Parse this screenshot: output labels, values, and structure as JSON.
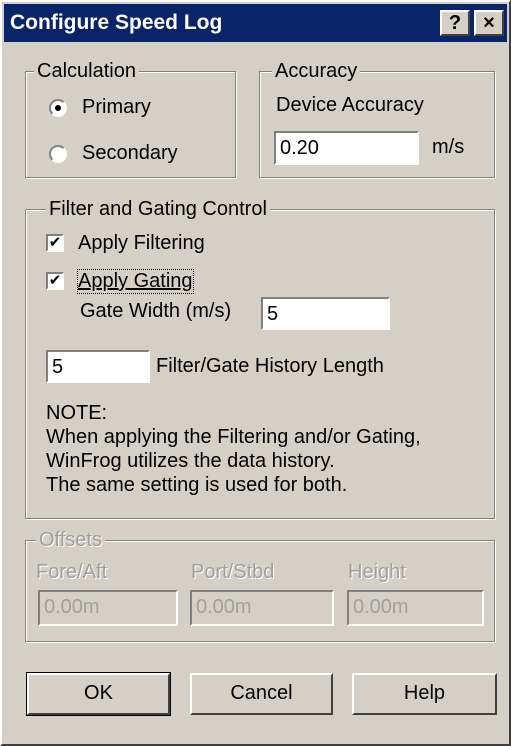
{
  "window": {
    "title": "Configure Speed Log",
    "help_button": "?",
    "close_button": "×"
  },
  "calculation": {
    "title": "Calculation",
    "options": [
      {
        "label": "Primary",
        "selected": true
      },
      {
        "label": "Secondary",
        "selected": false
      }
    ]
  },
  "accuracy": {
    "title": "Accuracy",
    "device_label": "Device Accuracy",
    "value": "0.20",
    "unit": "m/s"
  },
  "filter": {
    "title": "Filter and Gating Control",
    "apply_filtering": {
      "label": "Apply Filtering",
      "checked": true
    },
    "apply_gating": {
      "label": "Apply Gating",
      "checked": true
    },
    "gate_width_label": "Gate Width (m/s)",
    "gate_width_value": "5",
    "history_value": "5",
    "history_label": "Filter/Gate History Length",
    "note_title": "NOTE:",
    "note_line1": "When applying the Filtering and/or Gating,",
    "note_line2": "WinFrog utilizes the data history.",
    "note_line3": "The same setting is used for both."
  },
  "offsets": {
    "title": "Offsets",
    "fore_aft_label": "Fore/Aft",
    "fore_aft_value": "0.00m",
    "port_stbd_label": "Port/Stbd",
    "port_stbd_value": "0.00m",
    "height_label": "Height",
    "height_value": "0.00m"
  },
  "buttons": {
    "ok": "OK",
    "cancel": "Cancel",
    "help": "Help"
  },
  "check_mark": "✔"
}
